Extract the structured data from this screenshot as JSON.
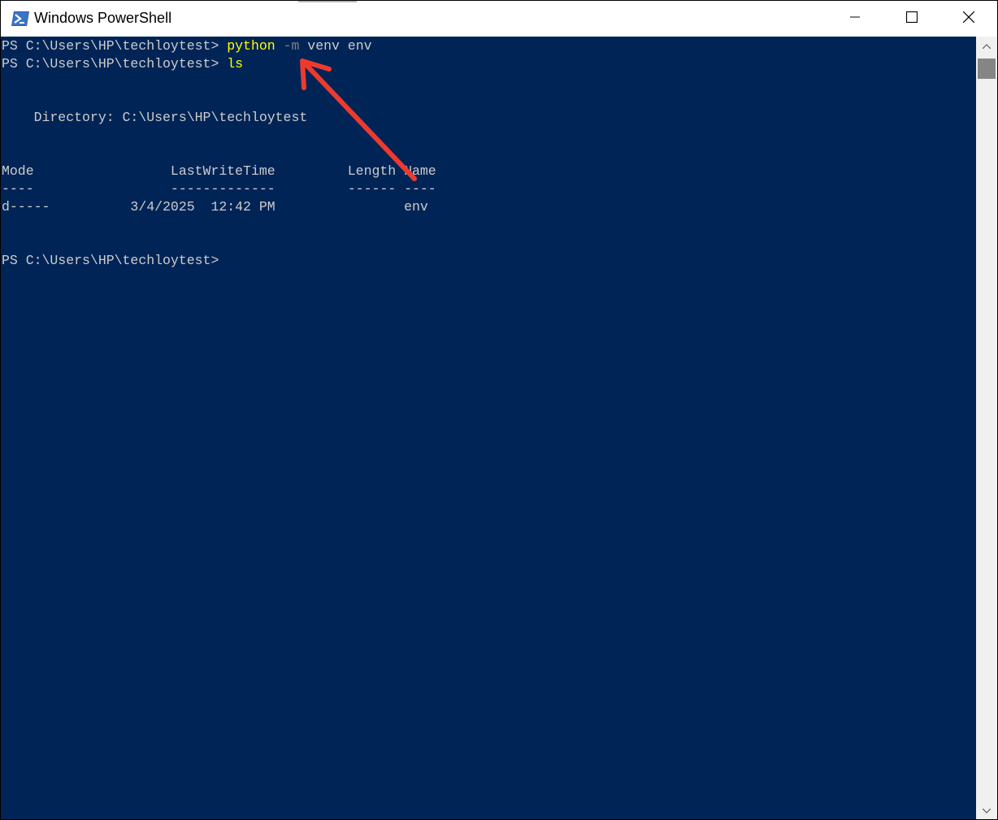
{
  "window": {
    "title": "Windows PowerShell",
    "icon": "powershell-icon",
    "controls": [
      "minimize-icon",
      "maximize-icon",
      "close-icon"
    ]
  },
  "console": {
    "bg_color": "#012456",
    "text_color": "#cccccc",
    "command_color": "#ffff00",
    "param_color": "#808080",
    "line1": {
      "prompt": "PS C:\\Users\\HP\\techloytest> ",
      "cmd": "python",
      "param": "-m",
      "args": "venv env"
    },
    "line2": {
      "prompt": "PS C:\\Users\\HP\\techloytest> ",
      "cmd": "ls"
    },
    "directory_line": "    Directory: C:\\Users\\HP\\techloytest",
    "table": {
      "header": "Mode                 LastWriteTime         Length Name",
      "underline": "----                 -------------         ------ ----",
      "rows": [
        "d-----          3/4/2025  12:42 PM                env"
      ]
    },
    "final_prompt": "PS C:\\Users\\HP\\techloytest>"
  },
  "annotation": {
    "arrow_color": "#ee3a2e",
    "arrow_icon": "red-arrow-icon"
  }
}
